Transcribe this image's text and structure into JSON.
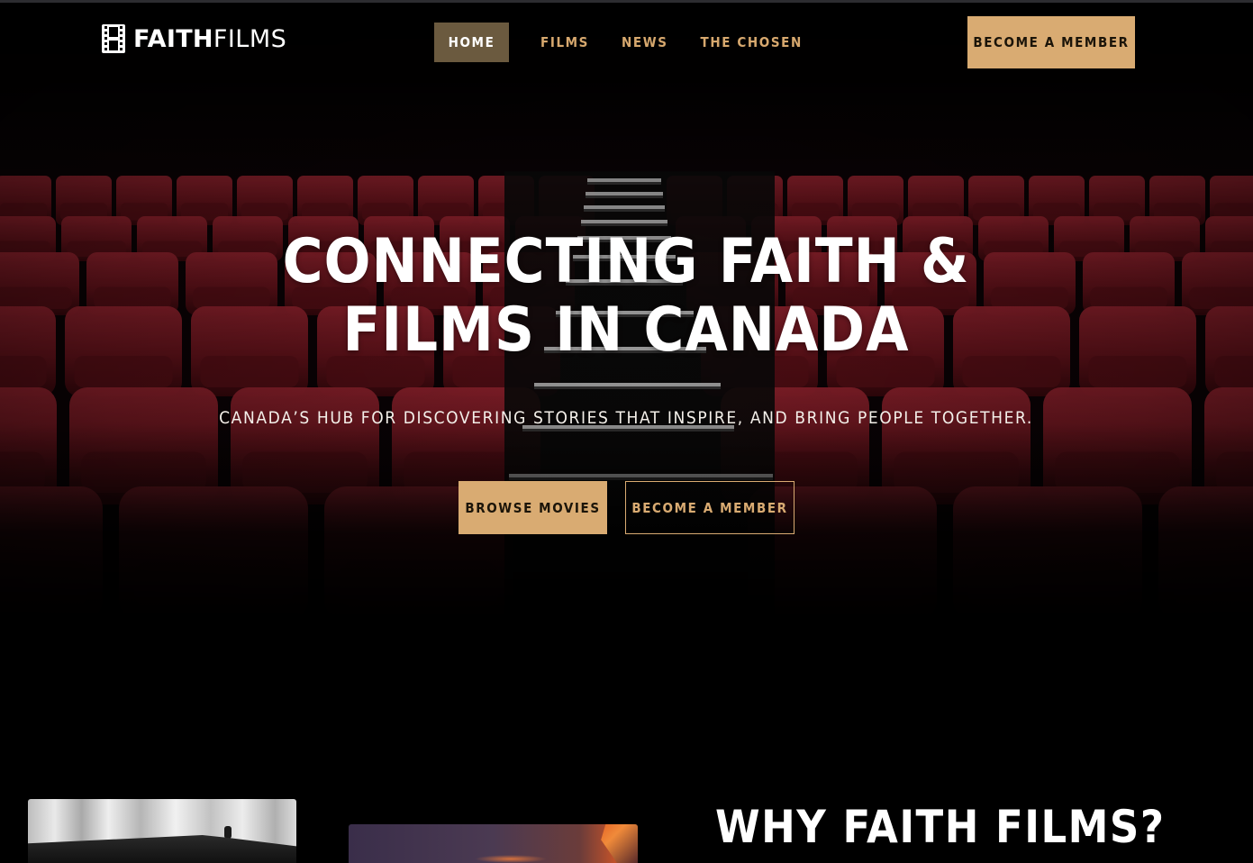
{
  "brand": {
    "name_bold": "FAITH",
    "name_light": "FILMS",
    "logo_icon": "film-strip-icon"
  },
  "nav": {
    "items": [
      {
        "label": "HOME",
        "active": true
      },
      {
        "label": "FILMS",
        "active": false
      },
      {
        "label": "NEWS",
        "active": false
      },
      {
        "label": "THE CHOSEN",
        "active": false
      }
    ],
    "cta_label": "BECOME A MEMBER"
  },
  "hero": {
    "title_line1": "CONNECTING FAITH &",
    "title_line2": "FILMS IN CANADA",
    "subtitle": "CANADA’S HUB FOR DISCOVERING STORIES THAT INSPIRE, AND BRING PEOPLE TOGETHER.",
    "primary_button": "BROWSE MOVIES",
    "secondary_button": "BECOME A MEMBER"
  },
  "why_section": {
    "title": "WHY FAITH FILMS?"
  },
  "colors": {
    "accent": "#d9ab72",
    "nav_active_bg": "#6b5a3f",
    "background": "#000000",
    "seat_red": "#8a1a24"
  }
}
